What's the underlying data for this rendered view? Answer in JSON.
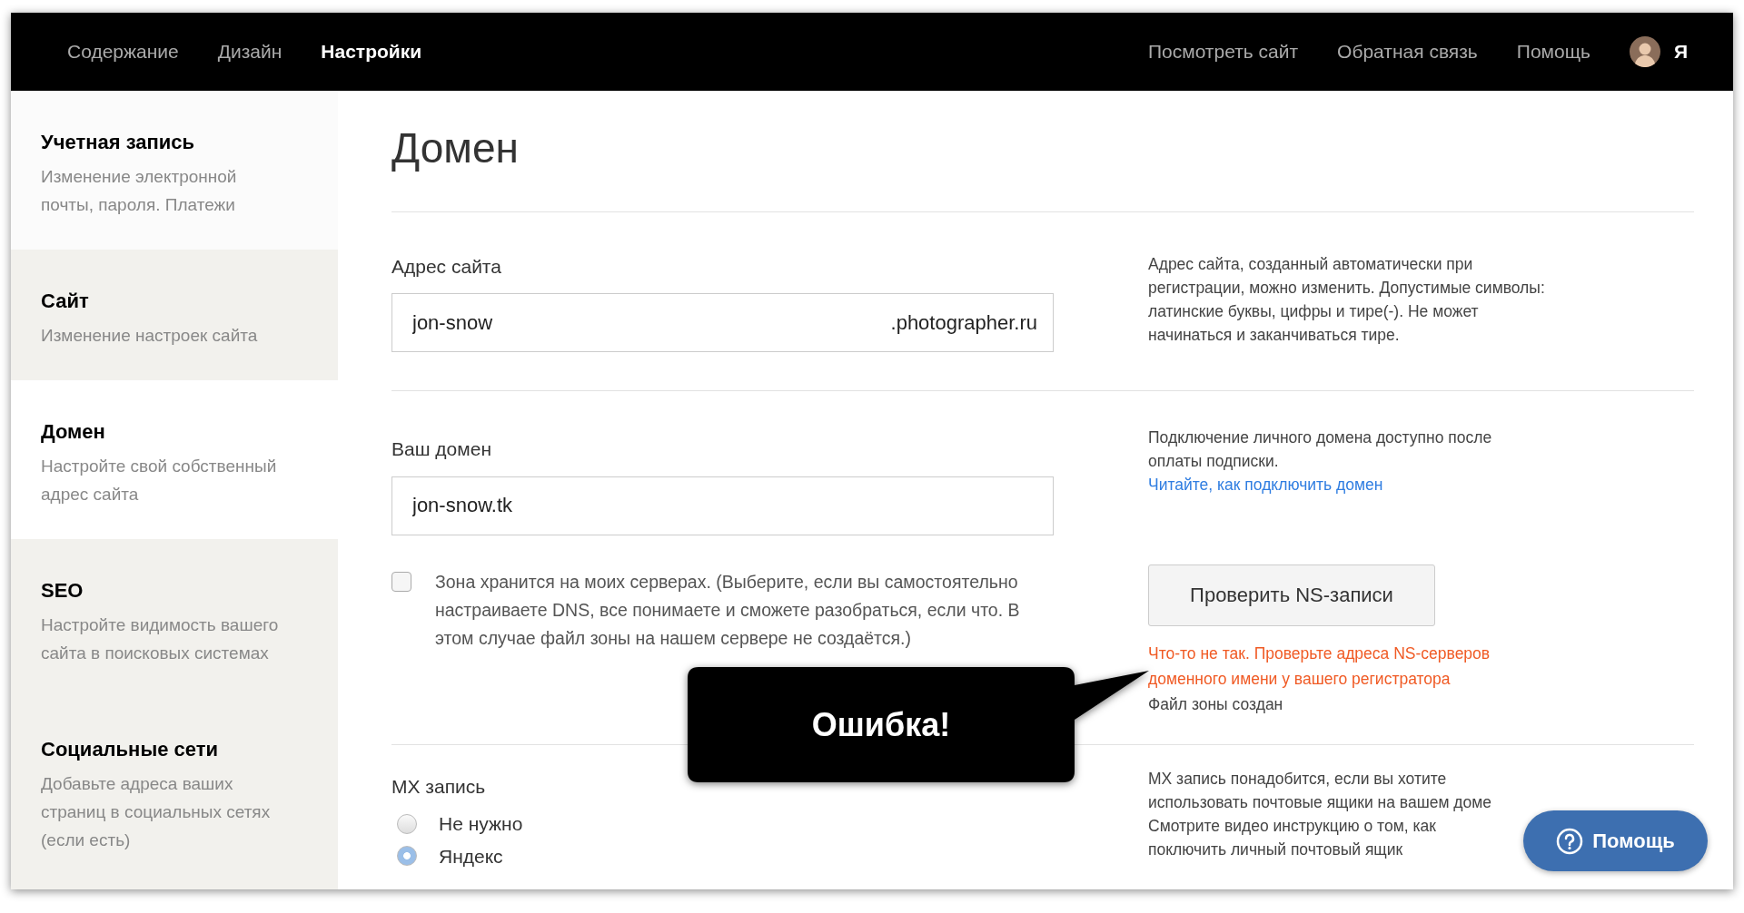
{
  "topnav": {
    "left": [
      {
        "label": "Содержание",
        "selected": false
      },
      {
        "label": "Дизайн",
        "selected": false
      },
      {
        "label": "Настройки",
        "selected": true
      }
    ],
    "right": [
      {
        "label": "Посмотреть сайт"
      },
      {
        "label": "Обратная связь"
      },
      {
        "label": "Помощь"
      }
    ],
    "user": {
      "label": "Я"
    }
  },
  "sidebar": {
    "items": [
      {
        "title": "Учетная запись",
        "description": "Изменение электронной почты, пароля. Платежи",
        "selected": false,
        "hovered": true
      },
      {
        "title": "Сайт",
        "description": "Изменение настроек сайта",
        "selected": false,
        "hovered": false
      },
      {
        "title": "Домен",
        "description": "Настройте свой собственный адрес сайта",
        "selected": true,
        "hovered": false
      },
      {
        "title": "SEO",
        "description": "Настройте видимость вашего сайта в поисковых системах",
        "selected": false,
        "hovered": false
      },
      {
        "title": "Социальные сети",
        "description": "Добавьте адреса ваших страниц в социальных сетях (если есть)",
        "selected": false,
        "hovered": false
      }
    ]
  },
  "page_title": "Домен",
  "site_address": {
    "label": "Адрес сайта",
    "value": "jon-snow",
    "suffix": ".photographer.ru",
    "help": "Адрес сайта, созданный автоматически при регистрации, можно изменить. Допустимые символы: латинские буквы, цифры и тире(-). Не может начинаться и заканчиваться тире."
  },
  "your_domain": {
    "label": "Ваш домен",
    "value": "jon-snow.tk",
    "help": "Подключение личного домена доступно после оплаты подписки.",
    "help_link": "Читайте, как подключить домен"
  },
  "zone": {
    "label": "Зона хранится на моих серверах. (Выберите, если вы самостоятельно настраиваете DNS, все понимаете и сможете разобраться, если что. В этом случае файл зоны на нашем сервере не создаётся.)",
    "checked": false,
    "button": "Проверить NS-записи",
    "error": "Что-то не так. Проверьте адреса NS-серверов доменного имени у вашего регистратора",
    "status": "Файл зоны создан"
  },
  "callout": {
    "text": "Ошибка!"
  },
  "mx": {
    "label": "MX запись",
    "options": [
      {
        "label": "Не нужно",
        "selected": false
      },
      {
        "label": "Яндекс",
        "selected": true
      }
    ],
    "help_lines": [
      "MX запись понадобится, если вы хотите",
      "использовать почтовые ящики на вашем доме",
      "Смотрите видео инструкцию о том, как",
      "поключить личный почтовый ящик"
    ]
  },
  "help_button": {
    "label": "Помощь"
  }
}
